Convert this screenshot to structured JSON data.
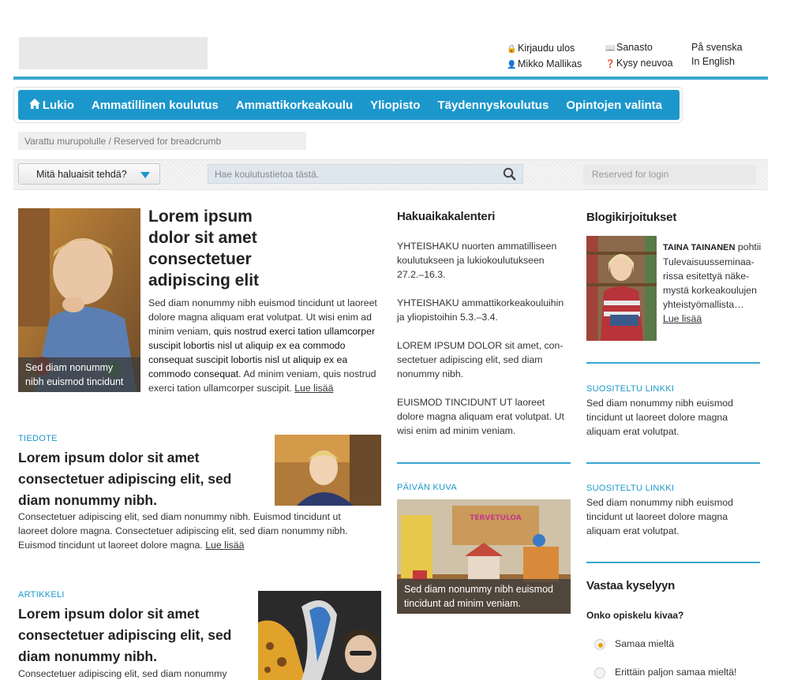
{
  "header": {
    "logout": "Kirjaudu ulos",
    "user": "Mikko Mallikas",
    "glossary": "Sanasto",
    "ask": "Kysy neuvoa",
    "swedish": "På svenska",
    "english": "In English"
  },
  "nav": {
    "items": [
      "Lukio",
      "Ammatillinen koulutus",
      "Ammattikorkeakoulu",
      "Yliopisto",
      "Täydennyskoulutus",
      "Opintojen valinta"
    ]
  },
  "breadcrumb": "Varattu murupolulle / Reserved for breadcrumb",
  "toolbar": {
    "dropdown": "Mitä haluaisit tehdä?",
    "search_placeholder": "Hae koulutustietoa tästä.",
    "login": "Reserved for login"
  },
  "lead": {
    "title": "Lorem ipsum dolor sit amet consectetuer adipiscing elit",
    "text_a": "Sed diam nonummy nibh euismod tincidunt ut laoreet dolore magna aliquam erat volutpat. Ut wisi enim ad minim veniam, ",
    "text_b": "quis nostrud exerci tation ullamcorper suscipit lobortis nisl ut aliquip ex ea commodo consequat suscipit lobortis nisl ut aliquip ex ea commodo consequat.",
    "text_c": " Ad minim veniam, quis nostrud exerci tation ullamcorper suscipit. ",
    "more": "Lue lisää",
    "caption": "Sed diam nonummy nibh euismod tincidunt"
  },
  "notice": {
    "kicker": "TIEDOTE",
    "title": "Lorem ipsum dolor sit amet consectetuer adipiscing elit, sed diam nonummy nibh.",
    "text": "Consectetuer adipiscing elit, sed diam nonummy nibh. Euismod tincidunt ut laoreet dolore magna. Consectetuer adipiscing elit, sed diam nonummy nibh. Euismod tincidunt ut laoreet dolore magna. ",
    "more": "Lue lisää"
  },
  "article": {
    "kicker": "ARTIKKELI",
    "title": "Lorem ipsum dolor sit amet consectetuer adipiscing elit, sed diam nonummy nibh.",
    "text": "Consectetuer adipiscing elit, sed diam nonummy"
  },
  "calendar": {
    "title": "Hakuaikakalenteri",
    "entries": [
      "YHTEISHAKU nuorten ammatilliseen koulutukseen ja lukiokoulutukseen 27.2.–16.3.",
      "YHTEISHAKU ammattikorkeakouluihin ja yliopistoihin 5.3.–3.4.",
      "LOREM IPSUM DOLOR sit amet, con-sectetuer adipiscing elit, sed diam nonummy nibh.",
      "EUISMOD TINCIDUNT UT laoreet dolore magna aliquam erat volutpat. Ut wisi enim ad minim veniam."
    ]
  },
  "photo_of_day": {
    "kicker": "PÄIVÄN KUVA",
    "sign": "TERVETULOA",
    "caption": "Sed diam nonummy nibh euismod tincidunt ad minim veniam."
  },
  "blog": {
    "title": "Blogikirjoitukset",
    "author": "TAINA TAINANEN",
    "text": " pohtii Tulevaisuusseminaa-rissa esitettyä näke-mystä korkeakoulujen yhteistyömallista…",
    "more": "Lue lisää"
  },
  "featured": [
    {
      "kicker": "SUOSITELTU LINKKI",
      "text": "Sed diam nonummy nibh euismod tincidunt ut laoreet dolore magna aliquam erat volutpat."
    },
    {
      "kicker": "SUOSITELTU LINKKI",
      "text": "Sed diam nonummy nibh euismod tincidunt ut laoreet dolore magna aliquam erat volutpat."
    }
  ],
  "poll": {
    "title": "Vastaa kyselyyn",
    "question": "Onko opiskelu kivaa?",
    "options": [
      "Samaa mieltä",
      "Erittäin paljon samaa mieltä!"
    ],
    "selected_index": 0
  },
  "colors": {
    "accent": "#1c97cc",
    "rule": "#3aa7cf"
  }
}
